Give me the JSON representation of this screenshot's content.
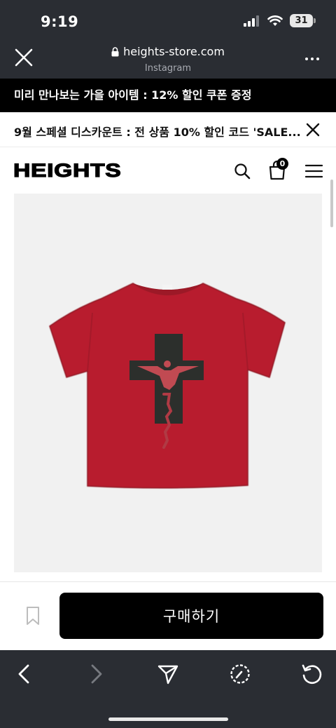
{
  "status_bar": {
    "time": "9:19",
    "battery": "31"
  },
  "browser": {
    "url": "heights-store.com",
    "source": "Instagram",
    "close_icon": "close-icon",
    "more_icon": "more-dots-icon"
  },
  "announcement": {
    "text": "미리 만나보는 가을 아이템 : 12% 할인 쿠폰 증정"
  },
  "promo": {
    "text": "9월 스페셜 디스카운트 : 전 상품 10% 할인 코드 'SALE..."
  },
  "site_header": {
    "logo": "HEIGHTS",
    "cart_count": "0"
  },
  "product": {
    "image_alt": "red t-shirt with black cross print",
    "colors": {
      "shirt": "#b81e2f",
      "cross": "#2c2f2c",
      "background": "#f1f1f1"
    }
  },
  "purchase": {
    "buy_label": "구매하기"
  },
  "toolbar": {
    "icons": [
      "back-icon",
      "forward-icon",
      "share-icon",
      "compass-icon",
      "reload-icon"
    ]
  },
  "colors": {
    "chrome_dark": "#2a2d33",
    "black": "#000000"
  }
}
